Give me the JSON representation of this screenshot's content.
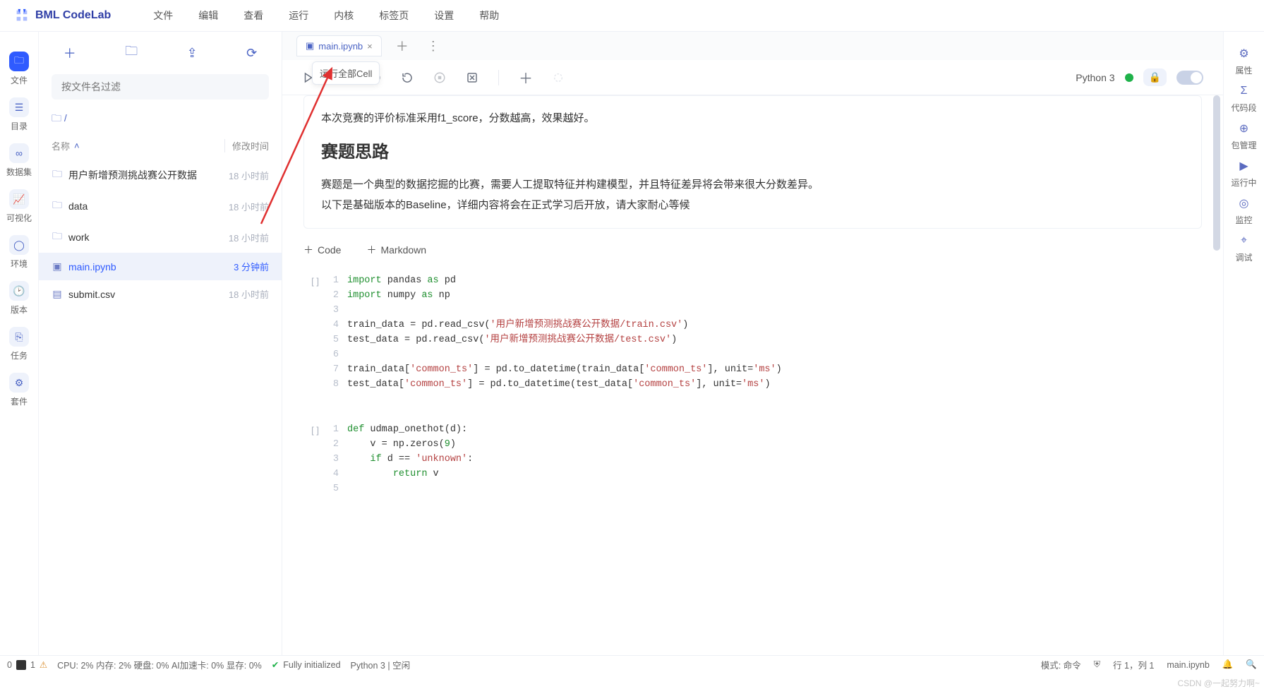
{
  "app": {
    "title": "BML CodeLab"
  },
  "menu": [
    "文件",
    "编辑",
    "查看",
    "运行",
    "内核",
    "标签页",
    "设置",
    "帮助"
  ],
  "left_rail": [
    {
      "icon": "folder",
      "label": "文件",
      "active": true
    },
    {
      "icon": "list",
      "label": "目录"
    },
    {
      "icon": "db",
      "label": "数据集"
    },
    {
      "icon": "chart",
      "label": "可视化"
    },
    {
      "icon": "env",
      "label": "环境"
    },
    {
      "icon": "clock",
      "label": "版本"
    },
    {
      "icon": "task",
      "label": "任务"
    },
    {
      "icon": "puzzle",
      "label": "套件"
    }
  ],
  "file_panel": {
    "filter_placeholder": "按文件名过滤",
    "breadcrumb": "/",
    "col_name": "名称",
    "col_time": "修改时间",
    "rows": [
      {
        "icon": "folder",
        "name": "用户新增预测挑战赛公开数据",
        "time": "18 小时前",
        "active": false
      },
      {
        "icon": "folder",
        "name": "data",
        "time": "18 小时前",
        "active": false
      },
      {
        "icon": "folder",
        "name": "work",
        "time": "18 小时前",
        "active": false
      },
      {
        "icon": "nb",
        "name": "main.ipynb",
        "time": "3 分钟前",
        "active": true
      },
      {
        "icon": "file",
        "name": "submit.csv",
        "time": "18 小时前",
        "active": false
      }
    ]
  },
  "tabs": {
    "open": "main.ipynb",
    "tooltip": "运行全部Cell"
  },
  "toolbar": {
    "kernel": "Python 3"
  },
  "markdown": {
    "l1": "本次竞赛的评价标准采用f1_score，分数越高，效果越好。",
    "h": "赛题思路",
    "l2": "赛题是一个典型的数据挖掘的比赛，需要人工提取特征并构建模型，并且特征差异将会带来很大分数差异。",
    "l3": "以下是基础版本的Baseline，详细内容将会在正式学习后开放，请大家耐心等候"
  },
  "add": {
    "code": "Code",
    "md": "Markdown"
  },
  "code1": [
    {
      "n": 1,
      "seg": [
        [
          "k-imp",
          "import"
        ],
        [
          "",
          " pandas "
        ],
        [
          "k-as",
          "as"
        ],
        [
          "",
          " pd"
        ]
      ]
    },
    {
      "n": 2,
      "seg": [
        [
          "k-imp",
          "import"
        ],
        [
          "",
          " numpy "
        ],
        [
          "k-as",
          "as"
        ],
        [
          "",
          " np"
        ]
      ]
    },
    {
      "n": 3,
      "seg": [
        [
          "",
          ""
        ]
      ]
    },
    {
      "n": 4,
      "seg": [
        [
          "",
          "train_data = pd.read_csv("
        ],
        [
          "k-str",
          "'用户新增预测挑战赛公开数据/train.csv'"
        ],
        [
          "",
          ")"
        ]
      ]
    },
    {
      "n": 5,
      "seg": [
        [
          "",
          "test_data = pd.read_csv("
        ],
        [
          "k-str",
          "'用户新增预测挑战赛公开数据/test.csv'"
        ],
        [
          "",
          ")"
        ]
      ]
    },
    {
      "n": 6,
      "seg": [
        [
          "",
          ""
        ]
      ]
    },
    {
      "n": 7,
      "seg": [
        [
          "",
          "train_data["
        ],
        [
          "k-str",
          "'common_ts'"
        ],
        [
          "",
          "] = pd.to_datetime(train_data["
        ],
        [
          "k-str",
          "'common_ts'"
        ],
        [
          "",
          "], unit="
        ],
        [
          "k-str",
          "'ms'"
        ],
        [
          "",
          ")"
        ]
      ]
    },
    {
      "n": 8,
      "seg": [
        [
          "",
          "test_data["
        ],
        [
          "k-str",
          "'common_ts'"
        ],
        [
          "",
          "] = pd.to_datetime(test_data["
        ],
        [
          "k-str",
          "'common_ts'"
        ],
        [
          "",
          "], unit="
        ],
        [
          "k-str",
          "'ms'"
        ],
        [
          "",
          ")"
        ]
      ]
    }
  ],
  "code2": [
    {
      "n": 1,
      "seg": [
        [
          "k-def",
          "def"
        ],
        [
          "",
          " udmap_onethot(d):"
        ]
      ]
    },
    {
      "n": 2,
      "seg": [
        [
          "",
          "    v = np.zeros("
        ],
        [
          "k-num",
          "9"
        ],
        [
          "",
          ")"
        ]
      ]
    },
    {
      "n": 3,
      "seg": [
        [
          "",
          "    "
        ],
        [
          "k-if",
          "if"
        ],
        [
          "",
          " d == "
        ],
        [
          "k-str",
          "'unknown'"
        ],
        [
          "",
          ":"
        ]
      ]
    },
    {
      "n": 4,
      "seg": [
        [
          "",
          "        "
        ],
        [
          "k-ret",
          "return"
        ],
        [
          "",
          " v"
        ]
      ]
    },
    {
      "n": 5,
      "seg": [
        [
          "",
          ""
        ]
      ]
    }
  ],
  "right_rail": [
    {
      "icon": "gear",
      "label": "属性"
    },
    {
      "icon": "code",
      "label": "代码段"
    },
    {
      "icon": "pkg",
      "label": "包管理"
    },
    {
      "icon": "play",
      "label": "运行中"
    },
    {
      "icon": "mon",
      "label": "监控"
    },
    {
      "icon": "bug",
      "label": "调试"
    }
  ],
  "status": {
    "left_num": "0",
    "right_num": "1",
    "cpu": "CPU:  2% 内存:  2% 硬盘:  0% AI加速卡:  0% 显存:  0%",
    "init": "Fully initialized",
    "kernel": "Python 3 | 空闲",
    "mode": "模式: 命令",
    "pos": "行 1，列 1",
    "file": "main.ipynb"
  },
  "watermark": "CSDN @一起努力啊~"
}
